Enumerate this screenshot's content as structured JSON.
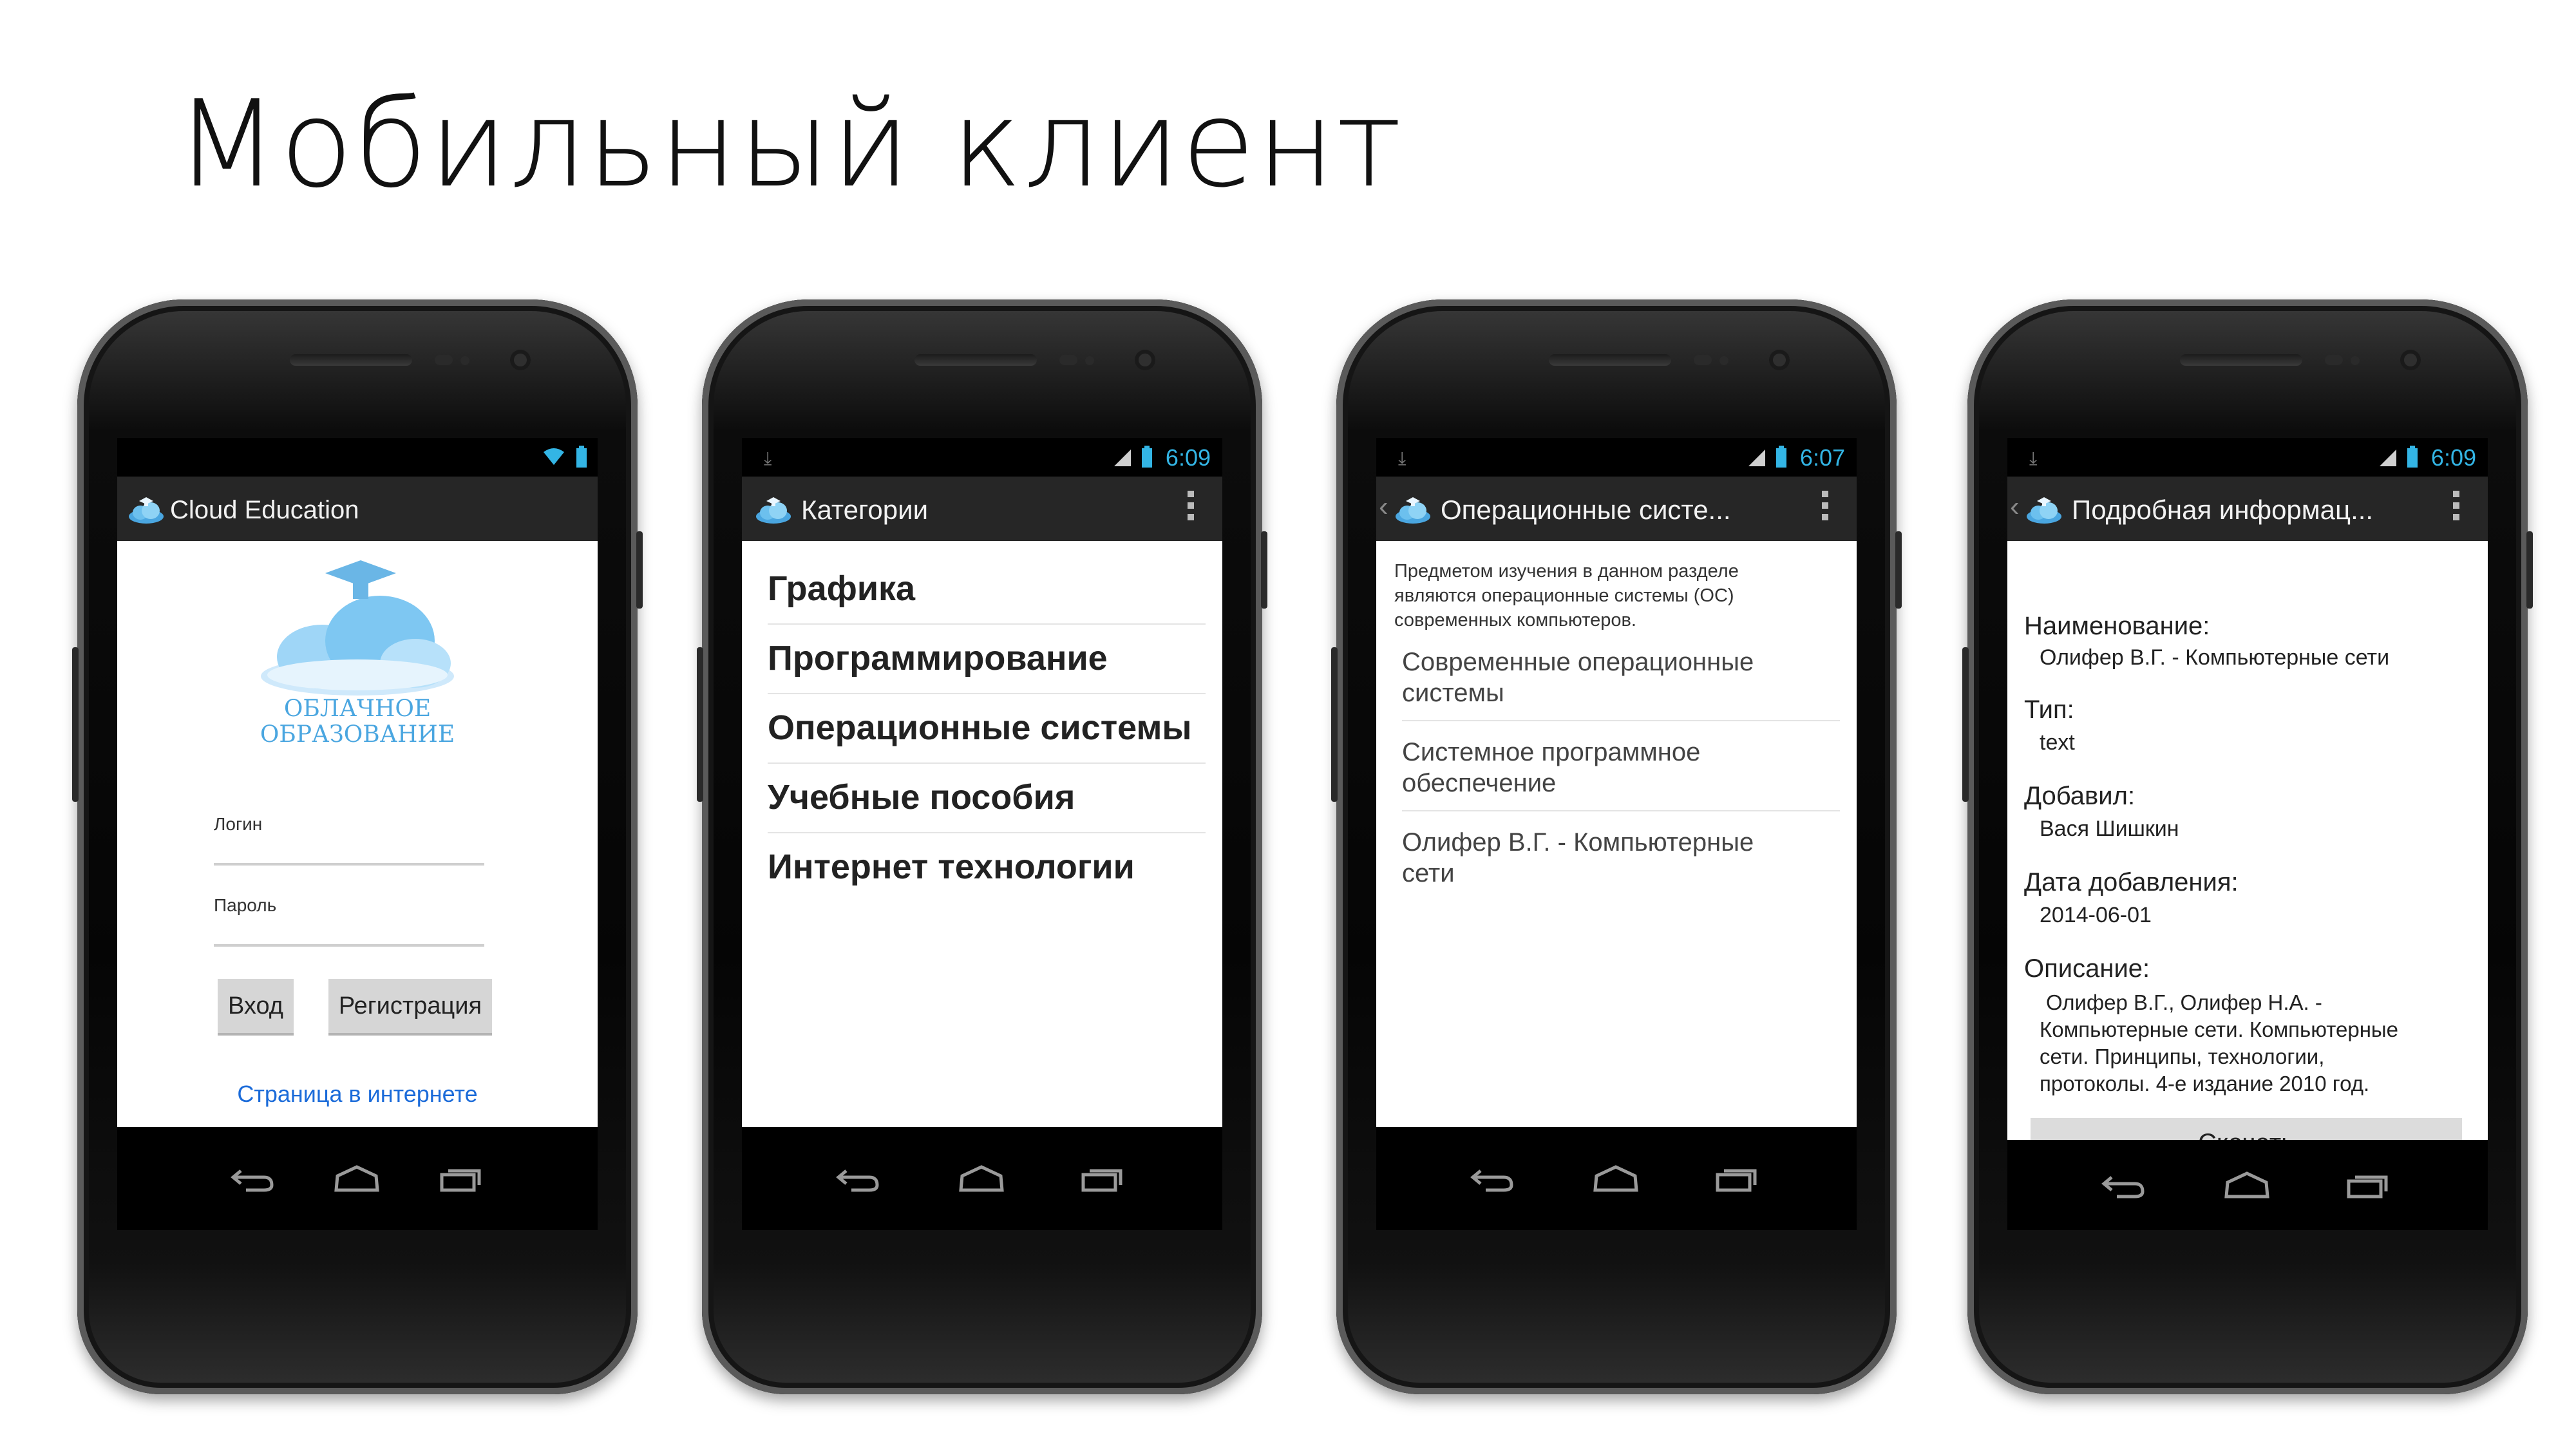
{
  "slide": {
    "title": "Мобильный клиент"
  },
  "phone1": {
    "app_title": "Cloud Education",
    "logo_text_line1": "ОБЛАЧНОЕ",
    "logo_text_line2": "ОБРАЗОВАНИЕ",
    "login_label": "Логин",
    "password_label": "Пароль",
    "login_button": "Вход",
    "register_button": "Регистрация",
    "web_link": "Страница в интернете"
  },
  "phone2": {
    "status_time": "6:09",
    "title": "Категории",
    "categories": [
      "Графика",
      "Программирование",
      "Операционные системы",
      "Учебные пособия",
      "Интернет технологии"
    ]
  },
  "phone3": {
    "status_time": "6:07",
    "title": "Операционные систе...",
    "intro_line1": "Предметом изучения в данном разделе",
    "intro_line2": "являются операционные системы (ОС)",
    "intro_line3": "современных компьютеров.",
    "items": [
      {
        "line1": "Современные операционные",
        "line2": "системы"
      },
      {
        "line1": "Системное программное",
        "line2": "обеспечение"
      },
      {
        "line1": "Олифер В.Г. - Компьютерные",
        "line2": "сети"
      }
    ]
  },
  "phone4": {
    "status_time": "6:09",
    "title": "Подробная информац...",
    "name_label": "Наименование:",
    "name_value": "Олифер В.Г. - Компьютерные сети",
    "type_label": "Тип:",
    "type_value": "text",
    "added_by_label": "Добавил:",
    "added_by_value": "Вася Шишкин",
    "date_label": "Дата добавления:",
    "date_value": "2014-06-01",
    "desc_label": "Описание:",
    "desc_line1": "Олифер В.Г., Олифер Н.А. -",
    "desc_line2": "Компьютерные сети. Компьютерные",
    "desc_line3": "сети. Принципы, технологии,",
    "desc_line4": "протоколы. 4-е издание 2010 год.",
    "download_button": "Скачать"
  },
  "colors": {
    "accent": "#33b5e5",
    "link": "#1b6bd9",
    "actionbar": "#262626"
  },
  "icons": [
    "app-logo-icon",
    "wifi-icon",
    "battery-icon",
    "signal-icon",
    "download-notification-icon",
    "overflow-menu-icon",
    "back-icon",
    "home-icon",
    "recent-apps-icon",
    "up-caret-icon"
  ]
}
